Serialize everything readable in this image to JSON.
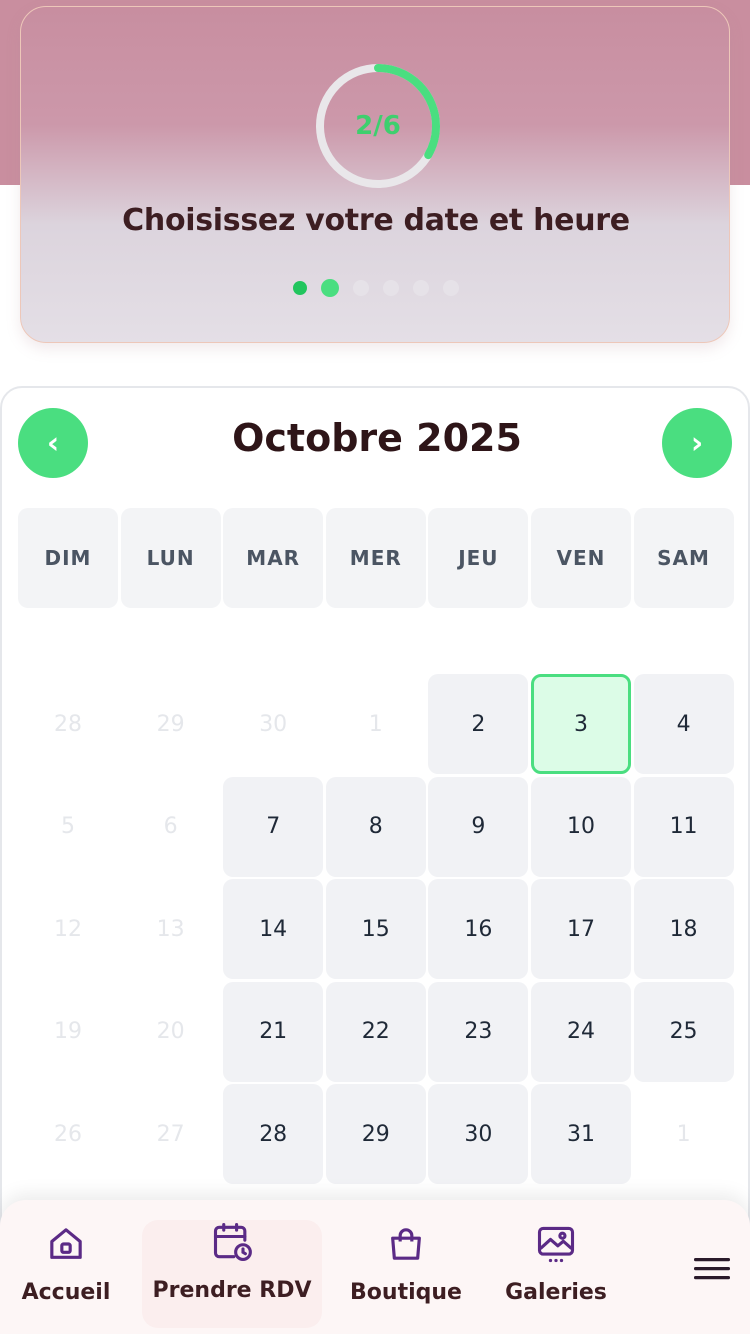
{
  "step": {
    "progress_label": "2/6",
    "progress_fraction": 0.3333,
    "title": "Choisissez votre date et heure",
    "current_step": 2,
    "total_steps": 6
  },
  "calendar": {
    "month_title": "Octobre 2025",
    "prev_icon": "chevron-left-icon",
    "next_icon": "chevron-right-icon",
    "weekdays": [
      "DIM",
      "LUN",
      "MAR",
      "MER",
      "JEU",
      "VEN",
      "SAM"
    ],
    "days": [
      {
        "label": "28",
        "state": "muted"
      },
      {
        "label": "29",
        "state": "muted"
      },
      {
        "label": "30",
        "state": "muted"
      },
      {
        "label": "1",
        "state": "muted"
      },
      {
        "label": "2",
        "state": "available"
      },
      {
        "label": "3",
        "state": "selected"
      },
      {
        "label": "4",
        "state": "available"
      },
      {
        "label": "5",
        "state": "muted"
      },
      {
        "label": "6",
        "state": "muted"
      },
      {
        "label": "7",
        "state": "available"
      },
      {
        "label": "8",
        "state": "available"
      },
      {
        "label": "9",
        "state": "available"
      },
      {
        "label": "10",
        "state": "available"
      },
      {
        "label": "11",
        "state": "available"
      },
      {
        "label": "12",
        "state": "muted"
      },
      {
        "label": "13",
        "state": "muted"
      },
      {
        "label": "14",
        "state": "available"
      },
      {
        "label": "15",
        "state": "available"
      },
      {
        "label": "16",
        "state": "available"
      },
      {
        "label": "17",
        "state": "available"
      },
      {
        "label": "18",
        "state": "available"
      },
      {
        "label": "19",
        "state": "muted"
      },
      {
        "label": "20",
        "state": "muted"
      },
      {
        "label": "21",
        "state": "available"
      },
      {
        "label": "22",
        "state": "available"
      },
      {
        "label": "23",
        "state": "available"
      },
      {
        "label": "24",
        "state": "available"
      },
      {
        "label": "25",
        "state": "available"
      },
      {
        "label": "26",
        "state": "muted"
      },
      {
        "label": "27",
        "state": "muted"
      },
      {
        "label": "28",
        "state": "available"
      },
      {
        "label": "29",
        "state": "available"
      },
      {
        "label": "30",
        "state": "available"
      },
      {
        "label": "31",
        "state": "available"
      },
      {
        "label": "1",
        "state": "muted"
      }
    ]
  },
  "bottom_nav": {
    "items": [
      {
        "label": "Accueil",
        "icon": "home-icon"
      },
      {
        "label": "Prendre RDV",
        "icon": "calendar-clock-icon"
      },
      {
        "label": "Boutique",
        "icon": "shopping-bag-icon"
      },
      {
        "label": "Galeries",
        "icon": "image-gallery-icon"
      }
    ],
    "menu_icon": "hamburger-menu-icon"
  },
  "colors": {
    "accent_green": "#4ade80",
    "dark_green": "#22c55e",
    "header_pink": "#c98e9f",
    "title_brown": "#3d1e22",
    "nav_icon_purple": "#5b2a86"
  }
}
